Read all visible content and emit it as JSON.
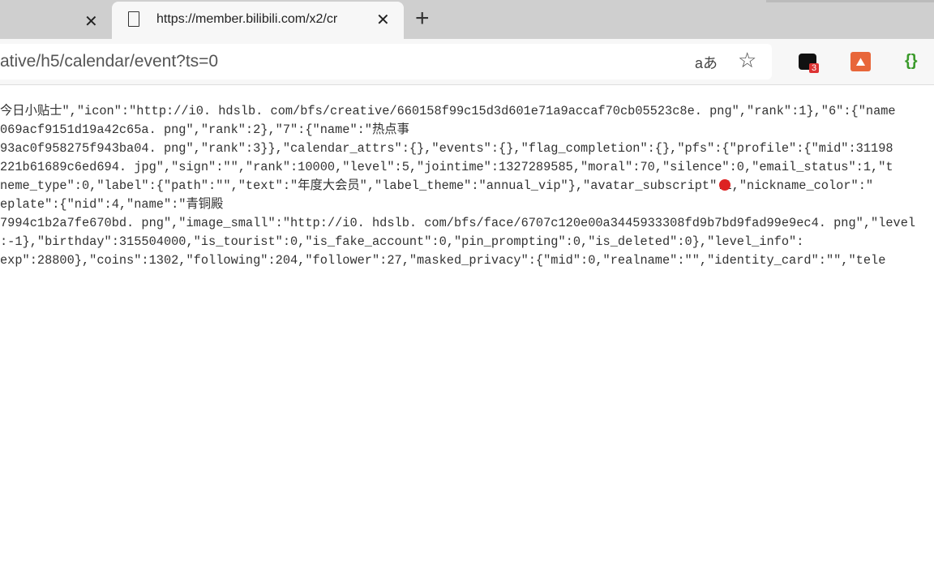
{
  "browser": {
    "active_tab_title": "https://member.bilibili.com/x2/cr",
    "address_url": "ative/h5/calendar/event?ts=0",
    "translate_label": "aあ",
    "extension_badge": "3"
  },
  "content": {
    "lines": [
      "今日小贴士\",\"icon\":\"http://i0. hdslb. com/bfs/creative/660158f99c15d3d601e71a9accaf70cb05523c8e. png\",\"rank\":1},\"6\":{\"name",
      "069acf9151d19a42c65a. png\",\"rank\":2},\"7\":{\"name\":\"热点事",
      "93ac0f958275f943ba04. png\",\"rank\":3}},\"calendar_attrs\":{},\"events\":{},\"flag_completion\":{},\"pfs\":{\"profile\":{\"mid\":31198",
      "221b61689c6ed694. jpg\",\"sign\":\"\",\"rank\":10000,\"level\":5,\"jointime\":1327289585,\"moral\":70,\"silence\":0,\"email_status\":1,\"t",
      "neme_type\":0,\"label\":{\"path\":\"\",\"text\":\"年度大会员\",\"label_theme\":\"annual_vip\"},\"avatar_subscript\":1,\"nickname_color\":\"",
      "eplate\":{\"nid\":4,\"name\":\"青铜殿",
      "7994c1b2a7fe670bd. png\",\"image_small\":\"http://i0. hdslb. com/bfs/face/6707c120e00a3445933308fd9b7bd9fad99e9ec4. png\",\"level",
      ":-1},\"birthday\":315504000,\"is_tourist\":0,\"is_fake_account\":0,\"pin_prompting\":0,\"is_deleted\":0},\"level_info\":",
      "exp\":28800},\"coins\":1302,\"following\":204,\"follower\":27,\"masked_privacy\":{\"mid\":0,\"realname\":\"\",\"identity_card\":\"\",\"tele"
    ]
  }
}
